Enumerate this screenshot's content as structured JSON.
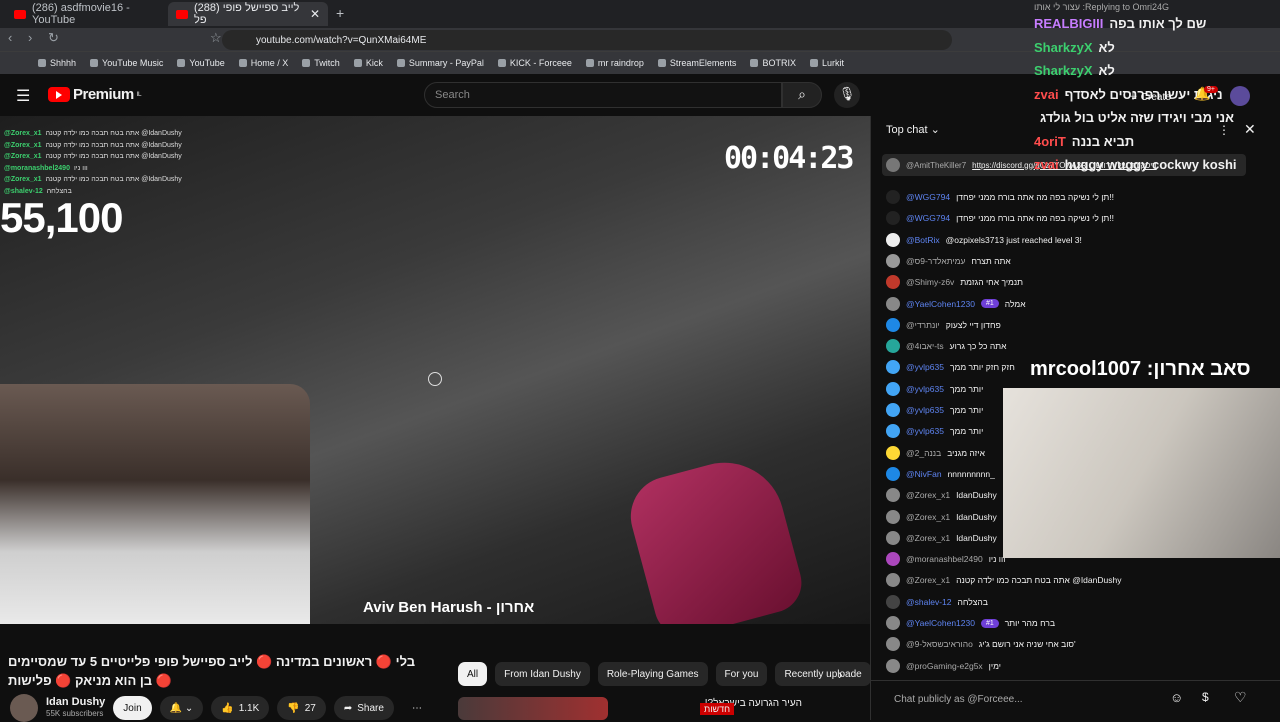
{
  "browser": {
    "tabs": [
      {
        "label": "(286) asdfmovie16 - YouTube"
      },
      {
        "label": "(288) לייב ספיישל פופי פל"
      }
    ],
    "url": "youtube.com/watch?v=QunXMai64ME",
    "bookmarks": [
      "Shhhh",
      "YouTube Music",
      "YouTube",
      "Home / X",
      "Twitch",
      "Kick",
      "Summary - PayPal",
      "KICK - Forceee",
      "mr raindrop",
      "StreamElements",
      "BOTRIX",
      "Lurkit"
    ]
  },
  "header": {
    "logo": "Premium",
    "region": "IL",
    "search_placeholder": "Search",
    "create": "Create",
    "notif": "9+"
  },
  "video": {
    "counter": "55,100",
    "timer": "00:04:23",
    "caption": "Aviv Ben Harush - אחרון",
    "overlay_chat": [
      {
        "u": "@Zorex_x1",
        "t": "אתה בטח תבכה כמו ילדה קטנה @IdanDushy"
      },
      {
        "u": "@Zorex_x1",
        "t": "אתה בטח תבכה כמו ילדה קטנה @IdanDushy"
      },
      {
        "u": "@Zorex_x1",
        "t": "אתה בטח תבכה כמו ילדה קטנה @IdanDushy"
      },
      {
        "u": "@moranashbel2490",
        "t": "ווו ניו"
      },
      {
        "u": "@Zorex_x1",
        "t": "אתה בטח תבכה כמו ילדה קטנה @IdanDushy"
      },
      {
        "u": "@shalev-12",
        "t": "בהצלחה"
      }
    ]
  },
  "below": {
    "title": "בלי 🔴 ראשונים במדינה 🔴 לייב ספיישל פופי פלייטיים 5 עד שמסיימים 🔴 בן הוא מניאק 🔴 פלישות",
    "channel": "Idan Dushy",
    "subs": "55K subscribers",
    "join": "Join",
    "likes": "1.1K",
    "dislikes": "27",
    "share": "Share",
    "chips": [
      "All",
      "From Idan Dushy",
      "Role-Playing Games",
      "For you",
      "Recently uploade"
    ],
    "next_title": "העיר הגרועה בישראל?!",
    "next_badge": "חדשות"
  },
  "chat": {
    "mode": "Top chat",
    "pinned_user": "@AmitTheKiller7",
    "pinned_text": "https://discord.gg/gCz7YOwA3R : דיסקורד של הדוושן",
    "messages": [
      {
        "u": "@WGG794",
        "t": "תן לי נשיקה בפה מה אתה בורח ממני יפחדן!!",
        "c": "#222"
      },
      {
        "u": "@WGG794",
        "t": "תן לי נשיקה בפה מה אתה בורח ממני יפחדן!!",
        "c": "#222"
      },
      {
        "u": "@BotRix",
        "t": "@ozpixels3713 just reached level 3!",
        "c": "#eee"
      },
      {
        "u": "@עמיתאלדר-9ס",
        "t": "אתה תצרח",
        "c": "#999"
      },
      {
        "u": "@Shimy-z6v",
        "t": "תנמיך אחי הגזמת",
        "c": "#c0392b"
      },
      {
        "u": "@YaelCohen1230",
        "t": "אמלה",
        "c": "#888",
        "b": "#1"
      },
      {
        "u": "@יונתרדי",
        "t": "פחדון דיי לצעוק",
        "c": "#1e88e5"
      },
      {
        "u": "@יאבו4-ts",
        "t": "אתה כל כך גרוע",
        "c": "#26a69a"
      },
      {
        "u": "@yvlp635",
        "t": "חזק חזק יותר ממך",
        "c": "#42a5f5"
      },
      {
        "u": "@yvlp635",
        "t": "יותר ממך",
        "c": "#42a5f5"
      },
      {
        "u": "@yvlp635",
        "t": "יותר ממך",
        "c": "#42a5f5"
      },
      {
        "u": "@yvlp635",
        "t": "יותר ממך",
        "c": "#42a5f5"
      },
      {
        "u": "@בננה_2",
        "t": "איזה מגניב",
        "c": "#fdd835"
      },
      {
        "u": "@NivFan",
        "t": "nnnnnnnnn_",
        "c": "#1e88e5"
      },
      {
        "u": "@Zorex_x1",
        "t": "IdanDushy",
        "c": "#888"
      },
      {
        "u": "@Zorex_x1",
        "t": "IdanDushy",
        "c": "#888"
      },
      {
        "u": "@Zorex_x1",
        "t": "IdanDushy",
        "c": "#888"
      },
      {
        "u": "@moranashbel2490",
        "t": "ווו ניו",
        "c": "#ab47bc"
      },
      {
        "u": "@Zorex_x1",
        "t": "אתה בטח תבכה כמו ילדה קטנה @IdanDushy",
        "c": "#888"
      },
      {
        "u": "@shalev-12",
        "t": "בהצלחה",
        "c": "#444"
      },
      {
        "u": "@YaelCohen1230",
        "t": "ברח מהר יותר",
        "c": "#888",
        "b": "#1"
      },
      {
        "u": "@הוראיבשסאל-9o",
        "t": "סוב אחי שניה אני רושם ג'יג'",
        "c": "#888"
      },
      {
        "u": "@proGaming-e2g5x",
        "t": "ימין",
        "c": "#888"
      }
    ],
    "input_placeholder": "Chat publicly as @Forceee..."
  },
  "overlay": {
    "reply": "Replying to Omri24G: עצור לי אותו",
    "lines": [
      {
        "n": "REALBIGIII",
        "t": "שם לך אותו בפה"
      },
      {
        "n": "SharkzyX",
        "t": "לא"
      },
      {
        "n": "SharkzyX",
        "t": "לא"
      },
      {
        "n": "zvai",
        "t": "ניגות יעשו רפרנסים לאסדף"
      },
      {
        "n": "",
        "t": "אני מבי ויגידו שזה אליט בול גולדג"
      },
      {
        "n": "4oriT",
        "t": "תביא בננה"
      },
      {
        "n": "zvai",
        "t": "huggy wuggy cockwy koshi"
      }
    ],
    "last_sub": "סאב אחרון: mrcool1007"
  }
}
